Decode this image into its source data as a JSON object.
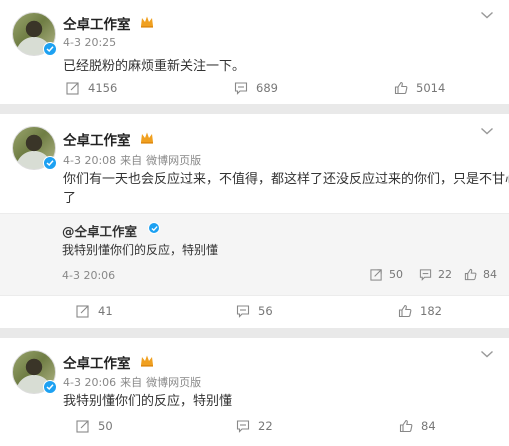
{
  "posts": [
    {
      "author": "仝卓工作室",
      "time": "4-3 20:25",
      "source_prefix": "",
      "client": "",
      "text": "已经脱粉的麻烦重新关注一下。",
      "reposts": "4156",
      "comments": "689",
      "likes": "5014"
    },
    {
      "author": "仝卓工作室",
      "time": "4-3 20:08",
      "source_prefix": "来自",
      "client": "微博网页版",
      "text_line1": "你们有一天也会反应过来，不值得，都这样了还没反应过来的你们，只是不甘心罢",
      "text_line2": "了",
      "quote": {
        "author": "@仝卓工作室",
        "text": "我特别懂你们的反应，特别懂",
        "time": "4-3 20:06",
        "reposts": "50",
        "comments": "22",
        "likes": "84"
      },
      "reposts": "41",
      "comments": "56",
      "likes": "182"
    },
    {
      "author": "仝卓工作室",
      "time": "4-3 20:06",
      "source_prefix": "来自",
      "client": "微博网页版",
      "text": "我特别懂你们的反应，特别懂",
      "reposts": "50",
      "comments": "22",
      "likes": "84"
    }
  ],
  "icons": {
    "repost": "repost-icon",
    "comment": "comment-icon",
    "like": "like-icon",
    "more": "chevron-down-icon",
    "verified": "verified-badge-icon",
    "crown": "crown-icon"
  },
  "colors": {
    "verified": "#1da1f2",
    "crown": "#f0a020",
    "background": "#e9e9e9"
  }
}
